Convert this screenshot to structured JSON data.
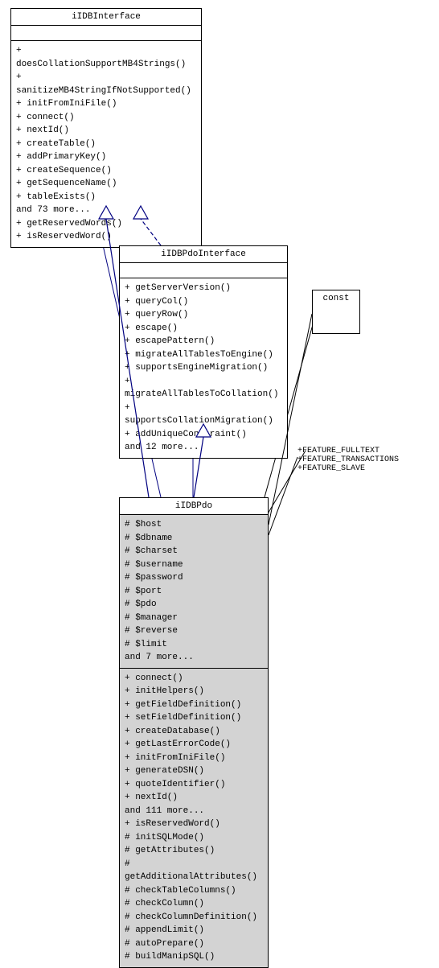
{
  "boxes": {
    "iIDBInterface": {
      "title": "iIDBInterface",
      "section1": "",
      "section2_lines": [
        "+ doesCollationSupportMB4Strings()",
        "+ sanitizeMB4StringIfNotSupported()",
        "+ initFromIniFile()",
        "+ connect()",
        "+ nextId()",
        "+ createTable()",
        "+ addPrimaryKey()",
        "+ createSequence()",
        "+ getSequenceName()",
        "+ tableExists()",
        "and 73 more...",
        "+ getReservedWords()",
        "+ isReservedWord()"
      ]
    },
    "iIDBPdoInterface": {
      "title": "iIDBPdoInterface",
      "section1": "",
      "section2_lines": [
        "+ getServerVersion()",
        "+ queryCol()",
        "+ queryRow()",
        "+ escape()",
        "+ escapePattern()",
        "+ migrateAllTablesToEngine()",
        "+ supportsEngineMigration()",
        "+ migrateAllTablesToCollation()",
        "+ supportsCollationMigration()",
        "+ addUniqueConstraint()",
        "and 12 more..."
      ]
    },
    "iIDBPdo": {
      "title": "iIDBPdo",
      "section1_lines": [
        "# $host",
        "# $dbname",
        "# $charset",
        "# $username",
        "# $password",
        "# $port",
        "# $pdo",
        "# $manager",
        "# $reverse",
        "# $limit",
        "and 7 more..."
      ],
      "section2_lines": [
        "+ connect()",
        "+ initHelpers()",
        "+ getFieldDefinition()",
        "+ setFieldDefinition()",
        "+ createDatabase()",
        "+ getLastErrorCode()",
        "+ initFromIniFile()",
        "+ generateDSN()",
        "+ quoteIdentifier()",
        "+ nextId()",
        "and 111 more...",
        "+ isReservedWord()",
        "# initSQLMode()",
        "# getAttributes()",
        "# getAdditionalAttributes()",
        "# checkTableColumns()",
        "# checkColumn()",
        "# checkColumnDefinition()",
        "# appendLimit()",
        "# autoPrepare()",
        "# buildManipSQL()"
      ]
    },
    "const_box": {
      "label": "const"
    }
  },
  "arrows": {
    "feature_labels": [
      "+FEATURE_FULLTEXT",
      "+FEATURE_TRANSACTIONS",
      "+FEATURE_SLAVE"
    ]
  }
}
